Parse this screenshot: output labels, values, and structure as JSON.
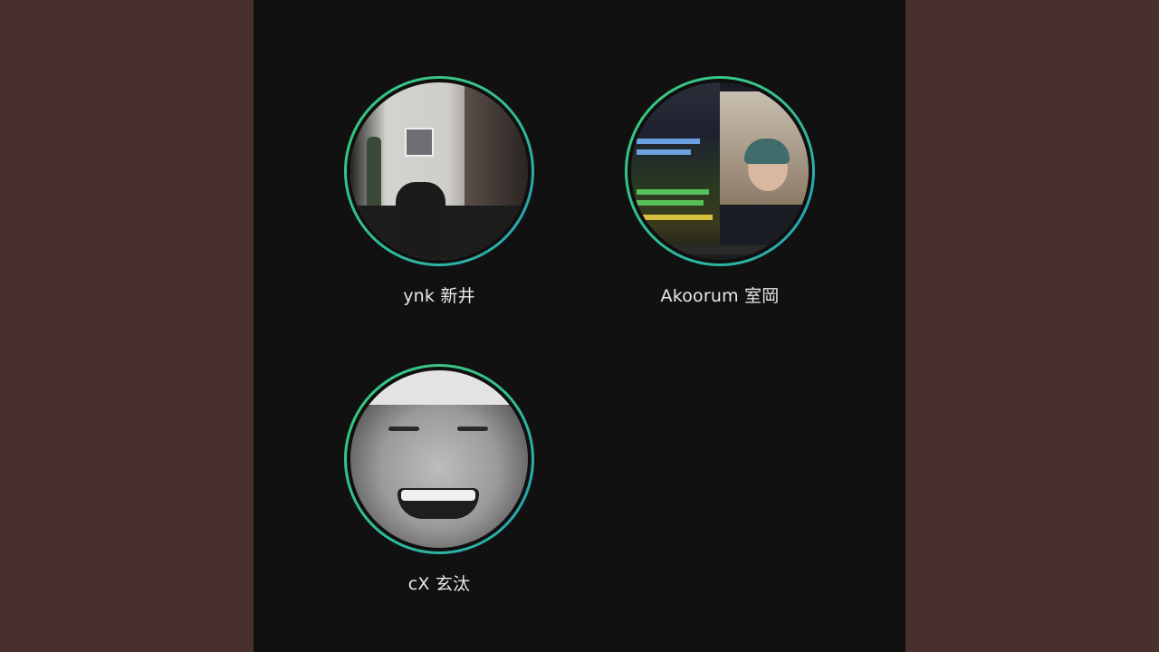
{
  "participants": [
    {
      "name": "ynk 新井"
    },
    {
      "name": "Akoorum 室岡"
    },
    {
      "name": "cX 玄汰"
    }
  ],
  "colors": {
    "background": "#4a302c",
    "panel": "#111111",
    "ring": "#36c77f"
  }
}
